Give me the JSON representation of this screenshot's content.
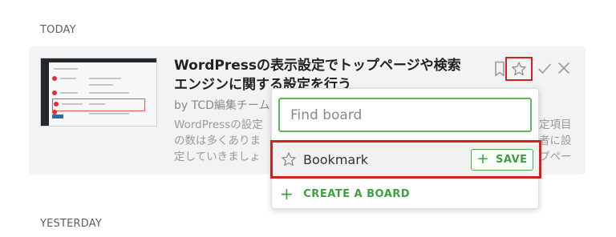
{
  "sections": {
    "today": "TODAY",
    "yesterday": "YESTERDAY"
  },
  "article": {
    "title": "WordPressの表示設定でトップページや検索エンジンに関する設定を行う",
    "author": "by TCD編集チーム",
    "excerpt_left": [
      "WordPressの設定",
      "の数は多くありま",
      "定していきましょ"
    ],
    "excerpt_right": [
      "定項目",
      "者に設",
      "プペー"
    ]
  },
  "icons": {
    "bookmark": "bookmark-icon",
    "star": "star-icon",
    "check": "check-icon",
    "close": "close-icon",
    "plus": "plus-icon"
  },
  "popup": {
    "search_placeholder": "Find board",
    "boards": [
      {
        "name": "Bookmark",
        "action_label": "SAVE"
      }
    ],
    "create_label": "CREATE A BOARD"
  },
  "colors": {
    "accent_green": "#3f9e3f",
    "highlight_red": "#d42020"
  }
}
